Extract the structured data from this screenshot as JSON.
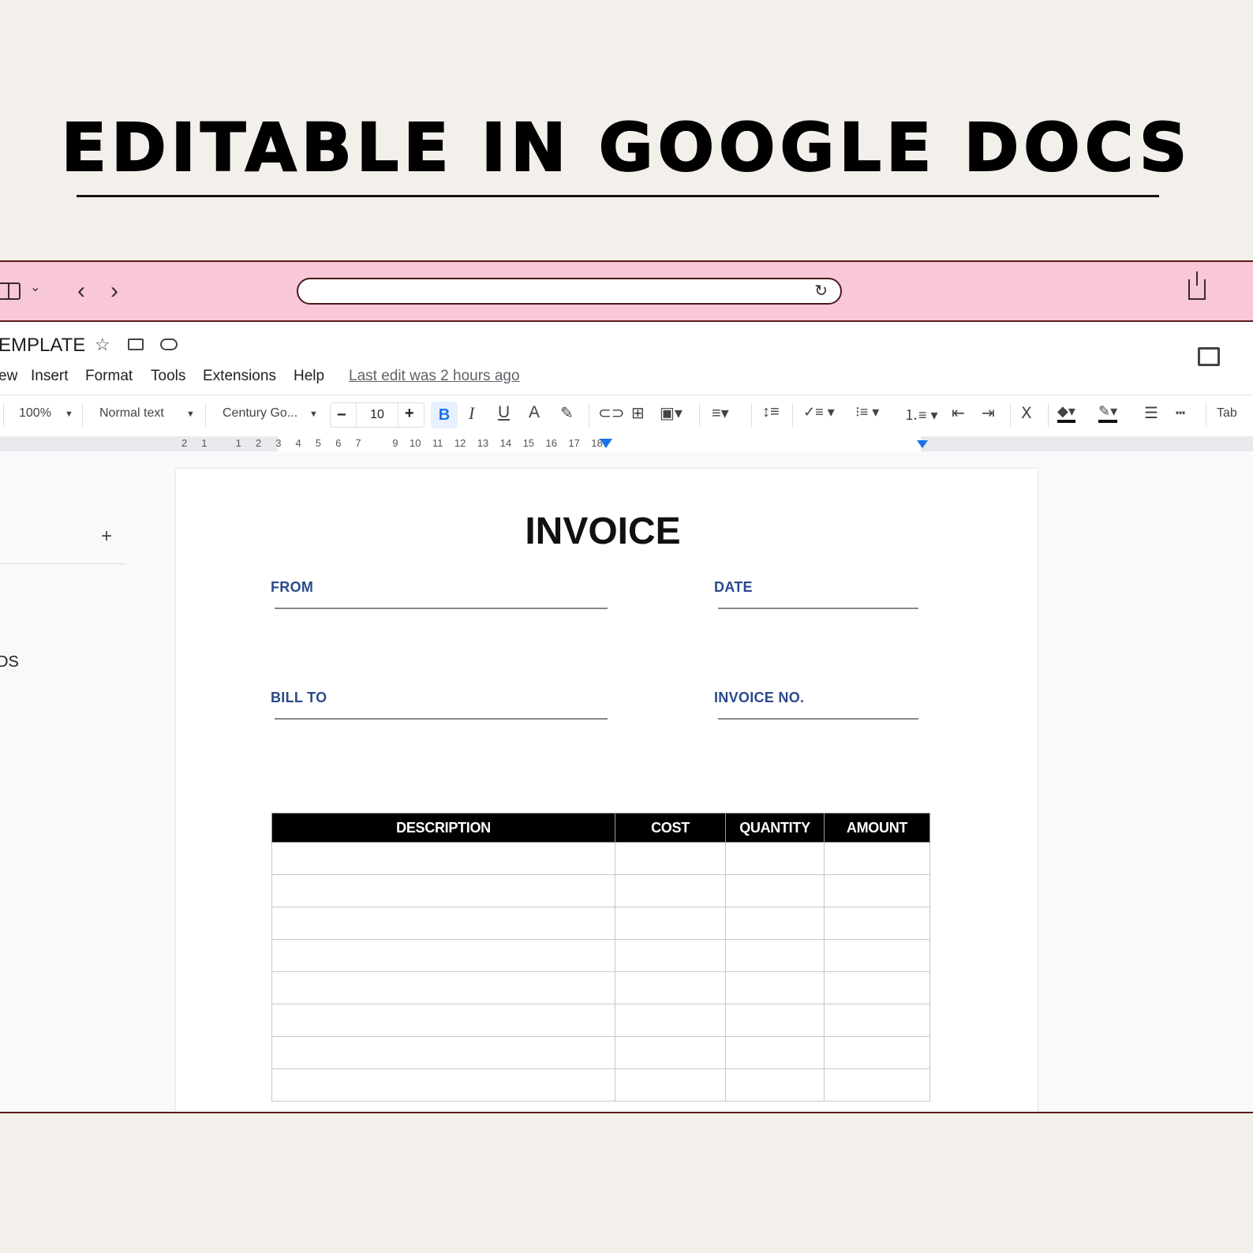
{
  "headline": "EDITABLE IN GOOGLE DOCS",
  "browser": {
    "sidebar_icon": "sidebar-icon",
    "back": "‹",
    "forward": "›",
    "reload": "↻",
    "share": "⇪"
  },
  "doc": {
    "title": "EMPLATE",
    "menus": [
      "ew",
      "Insert",
      "Format",
      "Tools",
      "Extensions",
      "Help"
    ],
    "last_edit": "Last edit was 2 hours ago"
  },
  "toolbar": {
    "zoom": "100%",
    "style": "Normal text",
    "font": "Century Go...",
    "font_size": "10",
    "minus": "−",
    "plus": "+",
    "bold": "B",
    "italic": "I",
    "underline": "U",
    "text_color": "A",
    "tab_label": "Tab"
  },
  "ruler": {
    "ticks": "2     1          1     2     3     4     5     6     7           9    10    11    12    13    14    15    16    17    18"
  },
  "sidebar": {
    "add": "+",
    "partial_text": "DS"
  },
  "page": {
    "title": "INVOICE",
    "from": "FROM",
    "date": "DATE",
    "bill_to": "BILL TO",
    "invoice_no": "INVOICE NO.",
    "table": {
      "headers": [
        "DESCRIPTION",
        "COST",
        "QUANTITY",
        "AMOUNT"
      ],
      "row_count": 8
    }
  },
  "colors": {
    "background": "#f3f0eb",
    "browser_bar": "#f8c8d8",
    "label_blue": "#2b4a8a"
  }
}
